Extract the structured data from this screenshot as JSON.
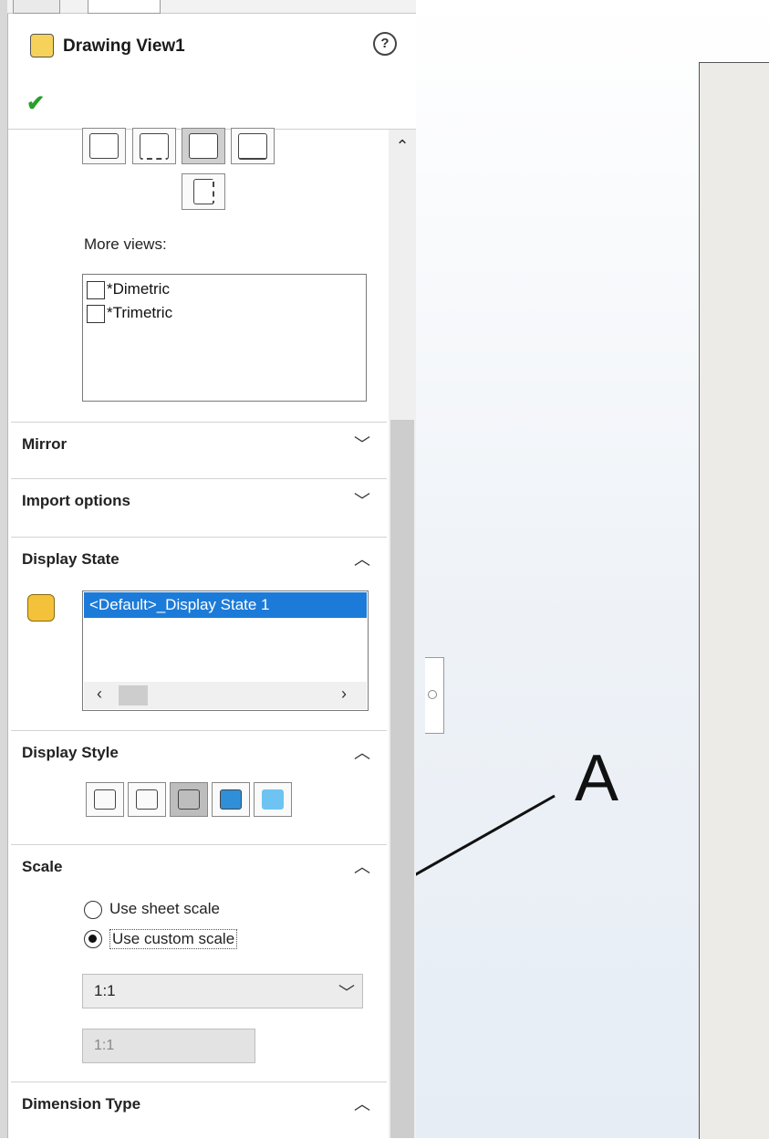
{
  "header": {
    "title": "Drawing View1",
    "help_icon": "help-icon",
    "ok_icon": "check-icon"
  },
  "orientation": {
    "more_views_label": "More views:",
    "more_views": [
      "*Dimetric",
      "*Trimetric"
    ]
  },
  "sections": {
    "mirror": "Mirror",
    "import_options": "Import options",
    "display_state": {
      "title": "Display State",
      "selected": "<Default>_Display State 1"
    },
    "display_style": "Display Style",
    "scale": {
      "title": "Scale",
      "options": [
        "Use sheet scale",
        "Use custom scale"
      ],
      "selected_index": 1,
      "dropdown_value": "1:1",
      "custom_value": "1:1"
    },
    "dimension_type": "Dimension Type"
  },
  "annotation": {
    "label": "A"
  },
  "colors": {
    "selection": "#1c7bd8",
    "ok_check": "#28a028"
  }
}
